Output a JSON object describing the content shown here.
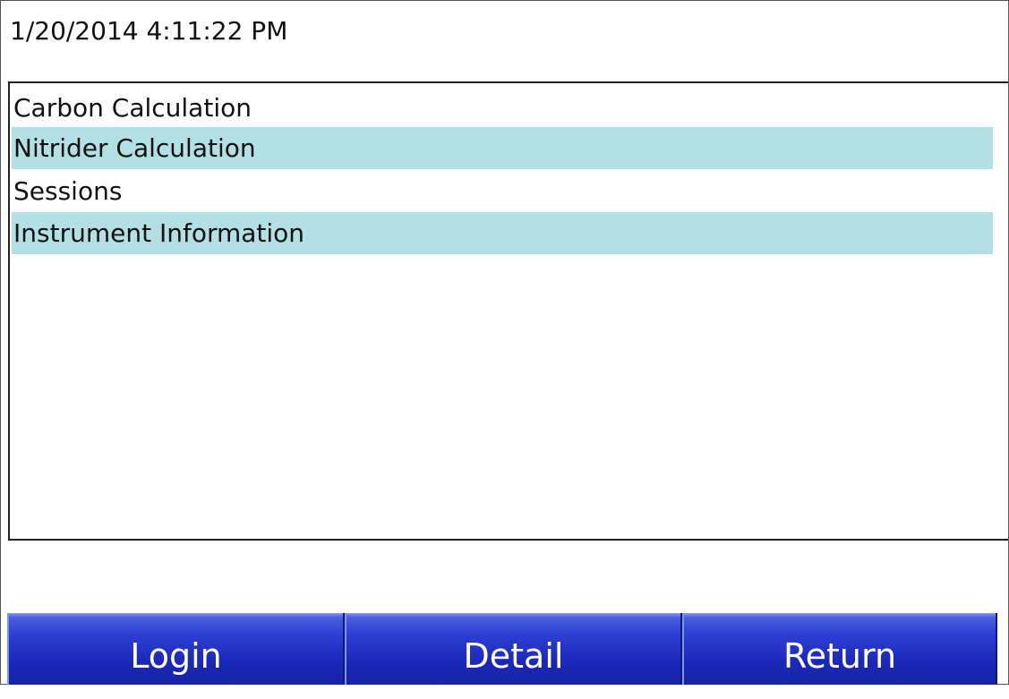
{
  "header": {
    "timestamp": "1/20/2014 4:11:22 PM"
  },
  "menu": {
    "items": [
      {
        "label": "Carbon Calculation"
      },
      {
        "label": "Nitrider Calculation"
      },
      {
        "label": "Sessions"
      },
      {
        "label": "Instrument Information"
      }
    ],
    "alt_row_color": "#b3e0e5"
  },
  "buttons": {
    "login_label": "Login",
    "detail_label": "Detail",
    "return_label": "Return"
  },
  "colors": {
    "button_blue": "#2d3ed4",
    "background": "#ffffff"
  }
}
